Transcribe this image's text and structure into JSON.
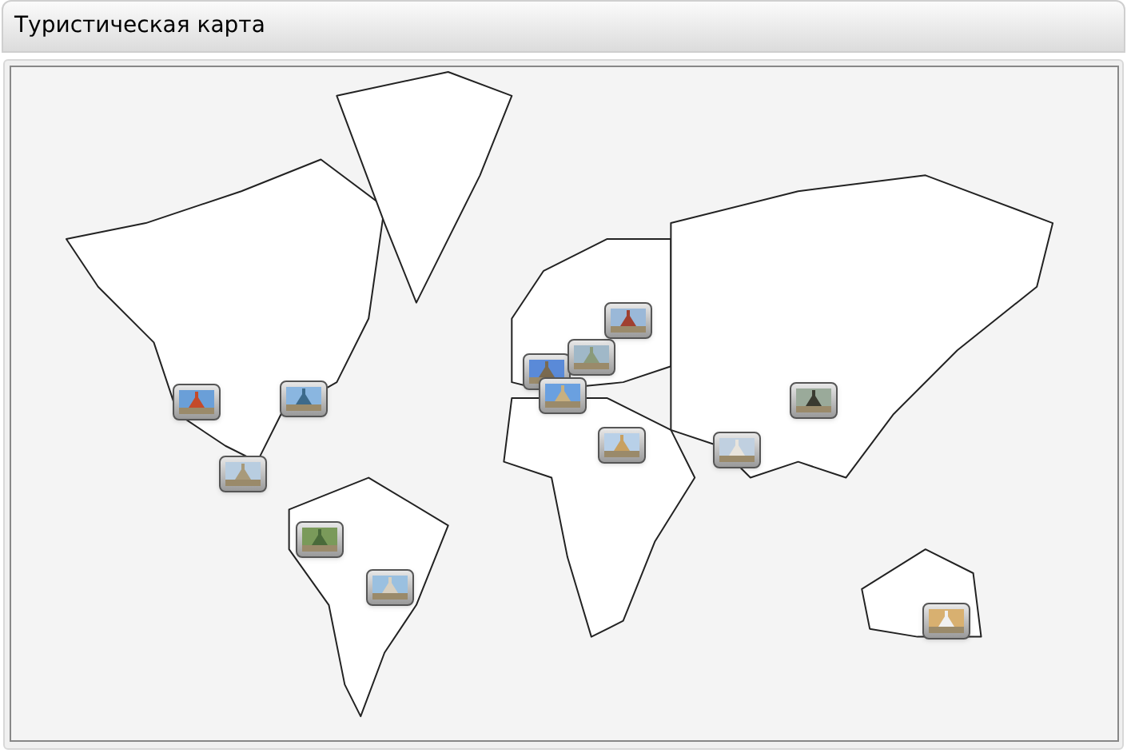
{
  "window": {
    "title": "Туристическая карта"
  }
}
